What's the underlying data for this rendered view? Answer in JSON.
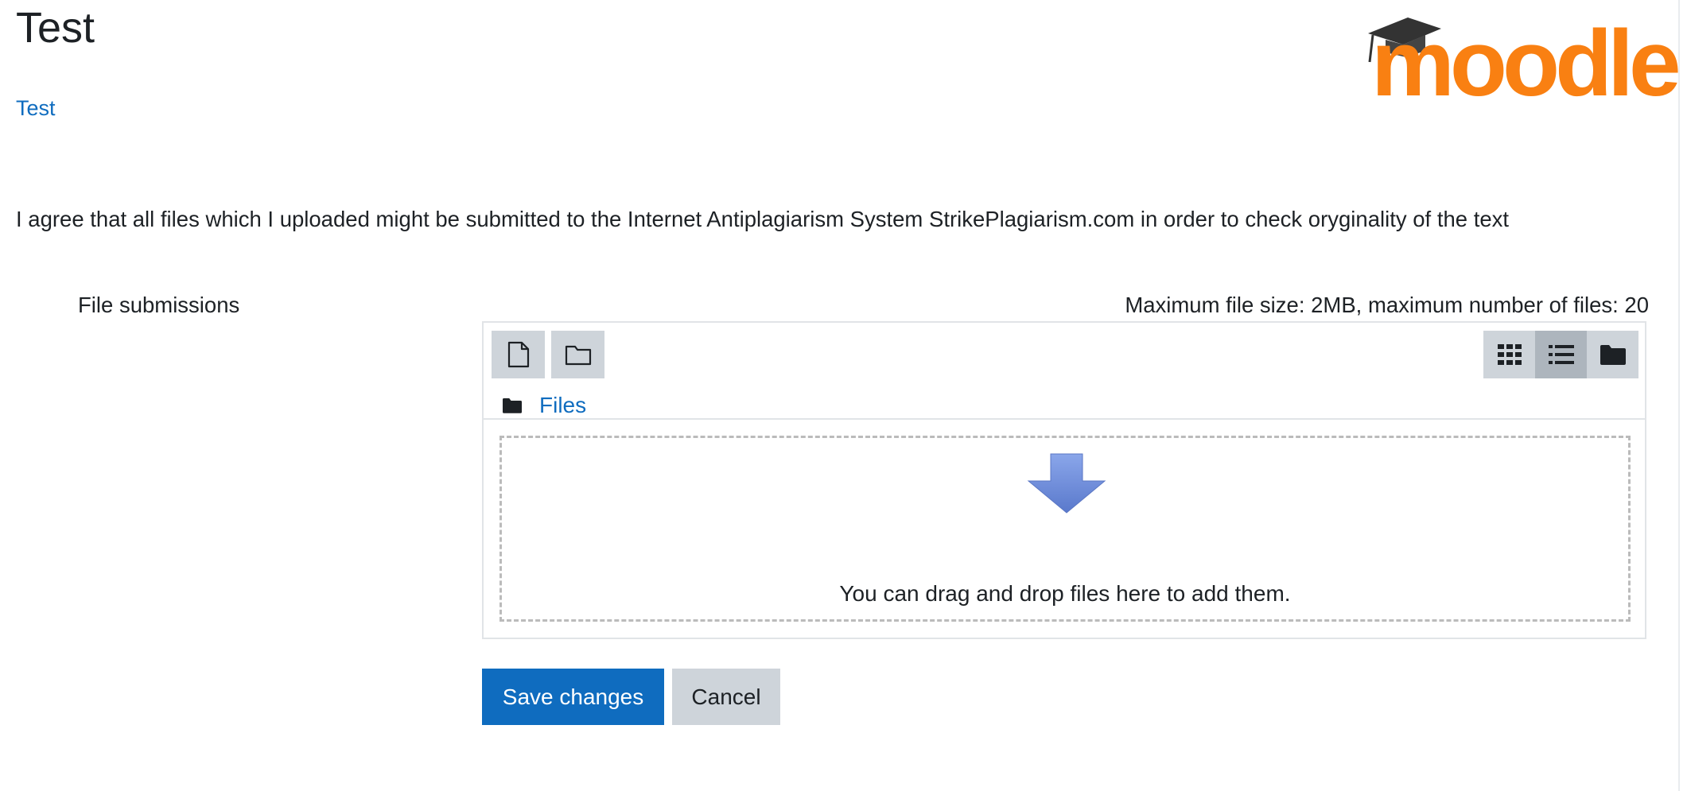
{
  "page": {
    "title": "Test",
    "breadcrumb_link": "Test",
    "logo_text": "moodle"
  },
  "agreement_text": "I agree that all files which I uploaded might be submitted to the Internet Antiplagiarism System StrikePlagiarism.com in order to check oryginality of the text",
  "file_submissions": {
    "label": "File submissions",
    "limits_text": "Maximum file size: 2MB, maximum number of files: 20",
    "toolbar": {
      "add_file_icon": "file-icon",
      "create_folder_icon": "folder-outline-icon",
      "views": [
        {
          "name": "icons-view",
          "icon": "grid-icon",
          "active": false
        },
        {
          "name": "list-view",
          "icon": "list-icon",
          "active": true
        },
        {
          "name": "tree-view",
          "icon": "folder-solid-icon",
          "active": false
        }
      ]
    },
    "path": {
      "icon": "folder-solid-icon",
      "label": "Files"
    },
    "dropzone": {
      "icon": "down-arrow-icon",
      "text": "You can drag and drop files here to add them."
    }
  },
  "buttons": {
    "save": "Save changes",
    "cancel": "Cancel"
  },
  "colors": {
    "link": "#0f6cbf",
    "primary": "#0f6cbf",
    "secondary": "#ced4da",
    "logo_orange": "#f98012",
    "arrow_blue": "#6f8fd8"
  }
}
